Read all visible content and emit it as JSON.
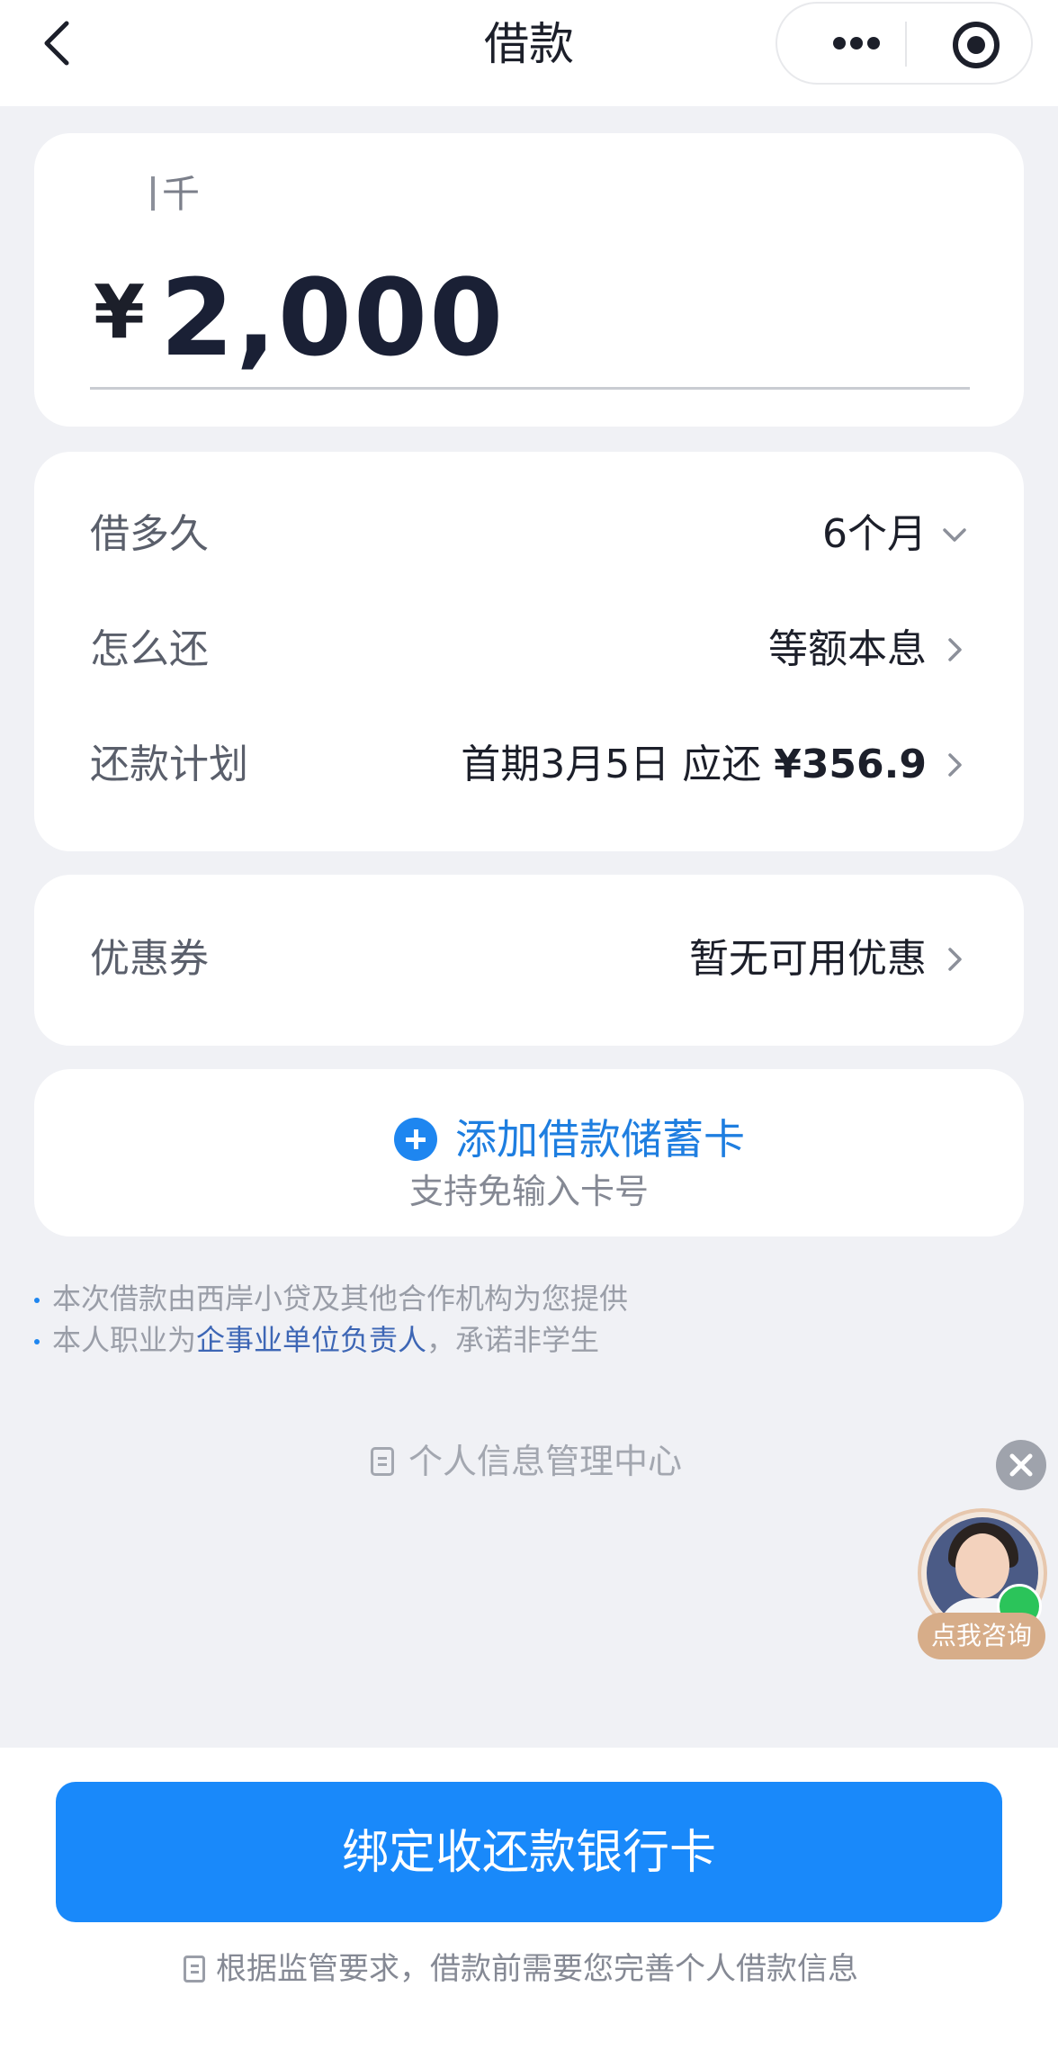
{
  "nav": {
    "title": "借款",
    "back_icon": "chevron-left-icon",
    "more_icon": "more-dots-icon",
    "capture_icon": "target-icon"
  },
  "amount": {
    "unit_hint": "千",
    "currency": "¥",
    "value": "2,000"
  },
  "loan_details": {
    "term_label": "借多久",
    "term_value": "6个月",
    "repay_label": "怎么还",
    "repay_value": "等额本息",
    "plan_label": "还款计划",
    "plan_prefix": "首期3月5日 应还",
    "plan_amount": "¥356.9"
  },
  "coupon": {
    "label": "优惠券",
    "value": "暂无可用优惠"
  },
  "bank_card": {
    "add_label": "添加借款储蓄卡",
    "sub_label": "支持免输入卡号"
  },
  "notes": {
    "line1": "本次借款由西岸小贷及其他合作机构为您提供",
    "line2_prefix": "本人职业为",
    "line2_highlight": "企事业单位负责人",
    "line2_suffix": "，承诺非学生"
  },
  "info_center": {
    "label": "个人信息管理中心"
  },
  "consult": {
    "label": "点我咨询"
  },
  "footer": {
    "button_label": "绑定收还款银行卡",
    "note": "根据监管要求，借款前需要您完善个人借款信息"
  },
  "colors": {
    "accent": "#1989fa",
    "link": "#1e7ee0",
    "background": "#f0f1f5",
    "consult_badge": "#d7ad89"
  }
}
